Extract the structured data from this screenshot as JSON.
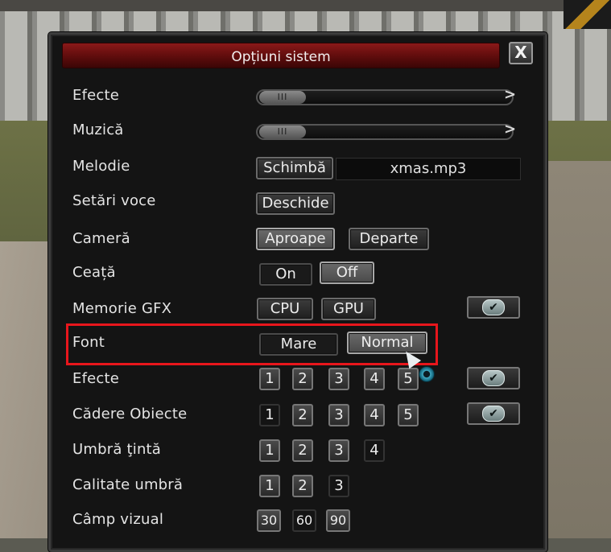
{
  "window": {
    "title": "Opțiuni sistem",
    "close_label": "X"
  },
  "rows": {
    "efecte_sunet": {
      "label": "Efecte",
      "slider_level": 0.2,
      "knob": "III",
      "arrow": ">"
    },
    "muzica": {
      "label": "Muzică",
      "slider_level": 0.2,
      "knob": "III",
      "arrow": ">"
    },
    "melodie": {
      "label": "Melodie",
      "button": "Schimbă",
      "song": "xmas.mp3"
    },
    "setari_voce": {
      "label": "Setări voce",
      "button": "Deschide"
    },
    "camera": {
      "label": "Cameră",
      "near": "Aproape",
      "far": "Departe",
      "selected": "Aproape"
    },
    "ceata": {
      "label": "Ceață",
      "on": "On",
      "off": "Off",
      "selected": "Off"
    },
    "memorie_gfx": {
      "label": "Memorie GFX",
      "cpu": "CPU",
      "gpu": "GPU",
      "checked": true,
      "check_icon": "check-icon"
    },
    "font": {
      "label": "Font",
      "large": "Mare",
      "normal": "Normal",
      "selected": "Normal"
    },
    "efecte_grafice": {
      "label": "Efecte",
      "levels": [
        "1",
        "2",
        "3",
        "4",
        "5"
      ],
      "selected": "5",
      "checked": true
    },
    "cadere_obiecte": {
      "label": "Cădere Obiecte",
      "levels": [
        "1",
        "2",
        "3",
        "4",
        "5"
      ],
      "checked": true
    },
    "umbra_tinta": {
      "label": "Umbră ţintă",
      "levels": [
        "1",
        "2",
        "3",
        "4"
      ]
    },
    "calitate_umbra": {
      "label": "Calitate umbră",
      "levels": [
        "1",
        "2",
        "3"
      ]
    },
    "camp_vizual": {
      "label": "Câmp vizual",
      "levels": [
        "30",
        "60",
        "90"
      ]
    }
  },
  "colors": {
    "title_bar": "#6e1010",
    "highlight": "#e8161c",
    "panel_bg": "#141414"
  }
}
